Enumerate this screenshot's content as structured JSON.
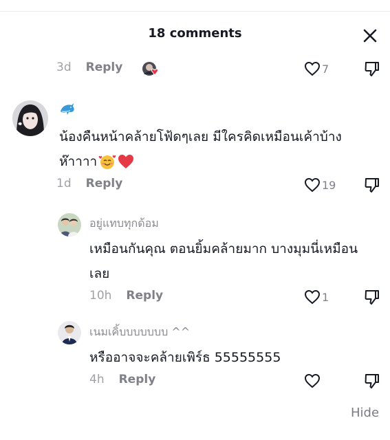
{
  "header": {
    "title": "18 comments"
  },
  "comments": [
    {
      "age": "3d",
      "reply_label": "Reply",
      "likes": "7"
    },
    {
      "username": "🐬",
      "text_line1": "น้องคืนหน้าคล้ายโฟ้ดๆเลย มีใครคิดเหมือนเค้าบ้าง",
      "text_line2": "ห๊าาาา",
      "age": "1d",
      "reply_label": "Reply",
      "likes": "19"
    }
  ],
  "replies": [
    {
      "username": "อยู่แทบทุกด้อม",
      "text_line1": "เหมือนกันคุณ ตอนยิ้มคล้ายมาก บางมุมนี่เหมือน",
      "text_line2": "เลย",
      "age": "10h",
      "reply_label": "Reply",
      "likes": "1"
    },
    {
      "username": "เนมเคิ้บบบบบบบ ^^",
      "text_line1": "หรืออาจจะคล้ายเพิร์ธ 55555555",
      "age": "4h",
      "reply_label": "Reply",
      "likes": ""
    }
  ],
  "footer": {
    "hide_label": "Hide"
  },
  "colors": {
    "heart_red": "#e8344b",
    "text_primary": "#161823",
    "text_muted": "#8a8a92"
  },
  "icons": [
    "close-icon",
    "heart-icon",
    "dislike-icon",
    "dolphin-emoji",
    "smiling-face-with-hearts-emoji",
    "red-heart-emoji"
  ]
}
